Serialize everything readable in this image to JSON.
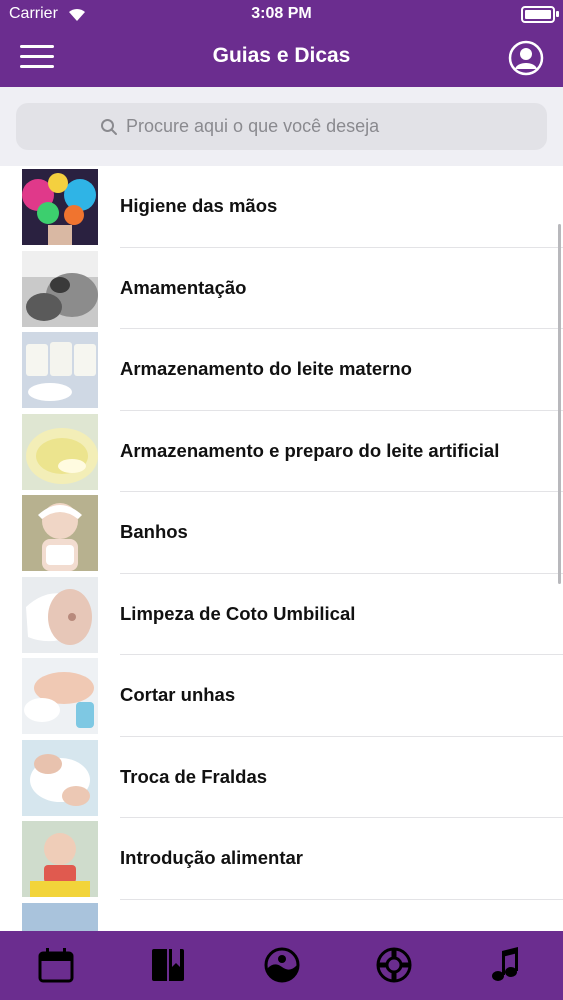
{
  "status_bar": {
    "carrier": "Carrier",
    "time": "3:08 PM"
  },
  "header": {
    "title": "Guias e Dicas",
    "menu_icon": "hamburger-menu-icon",
    "profile_icon": "user-profile-icon"
  },
  "search": {
    "placeholder": "Procure aqui o que você deseja",
    "value": ""
  },
  "list": {
    "items": [
      {
        "label": "Higiene das mãos",
        "image": "colorful-hands-photo"
      },
      {
        "label": "Amamentação",
        "image": "breastfeeding-photo"
      },
      {
        "label": "Armazenamento do leite materno",
        "image": "milk-bottles-photo"
      },
      {
        "label": "Armazenamento e preparo do leite artificial",
        "image": "formula-powder-photo"
      },
      {
        "label": "Banhos",
        "image": "baby-bath-photo"
      },
      {
        "label": "Limpeza de Coto Umbilical",
        "image": "umbilical-care-photo"
      },
      {
        "label": "Cortar unhas",
        "image": "baby-nails-photo"
      },
      {
        "label": "Troca de Fraldas",
        "image": "diaper-change-photo"
      },
      {
        "label": "Introdução alimentar",
        "image": "baby-food-photo"
      },
      {
        "label": "",
        "image": "partial-photo"
      }
    ]
  },
  "tabbar": {
    "tabs": [
      {
        "icon": "calendar-icon"
      },
      {
        "icon": "book-icon"
      },
      {
        "icon": "moon-landscape-icon"
      },
      {
        "icon": "lifebuoy-icon"
      },
      {
        "icon": "music-note-icon"
      }
    ]
  },
  "colors": {
    "brand": "#6b2d8f",
    "search_bg": "#efeff4",
    "field_bg": "#e2e2e7"
  }
}
